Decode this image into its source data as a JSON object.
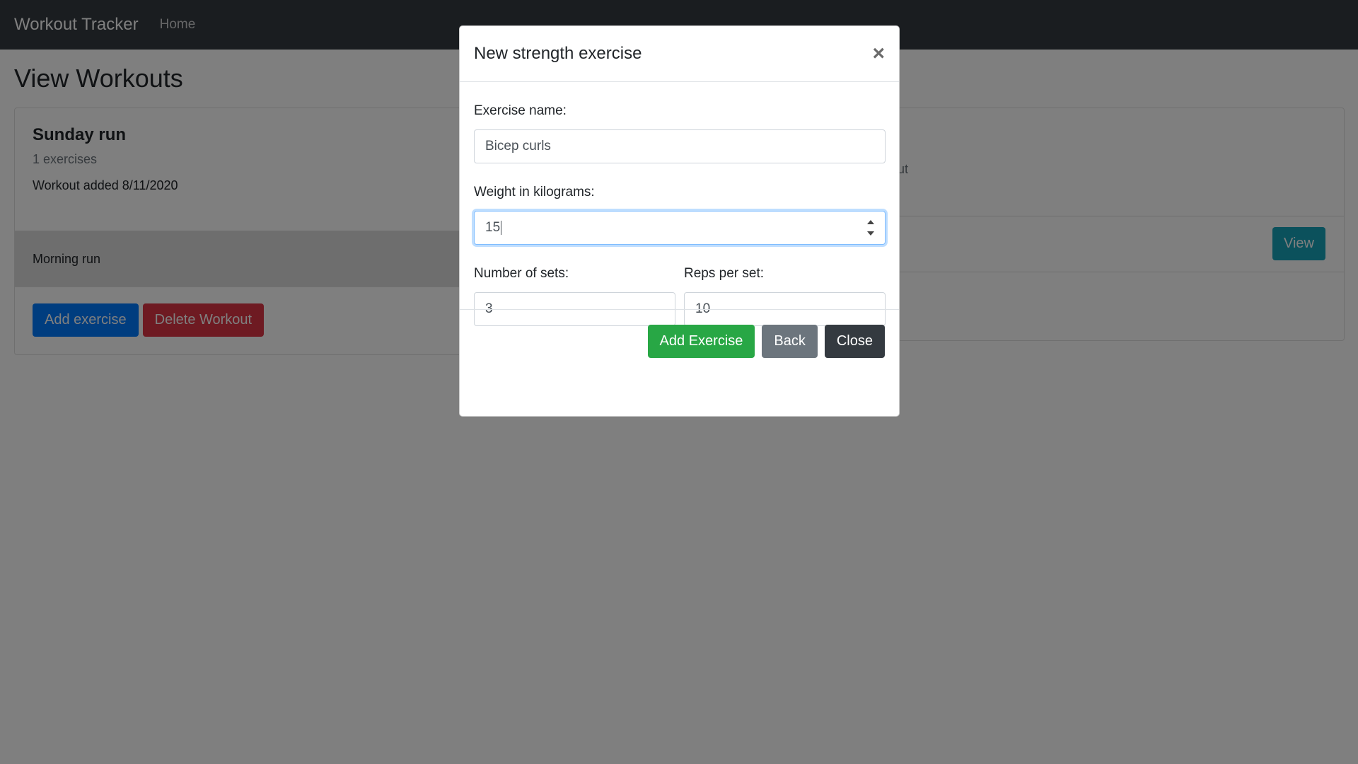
{
  "navbar": {
    "brand": "Workout Tracker",
    "home_link": "Home"
  },
  "page": {
    "title": "View Workouts"
  },
  "left_card": {
    "title": "Sunday run",
    "subtitle": "1 exercises",
    "text": "Workout added 8/11/2020",
    "list_item": "Morning run",
    "add_exercise_label": "Add exercise",
    "delete_workout_label": "Delete Workout"
  },
  "right_card": {
    "subtitle_fragment": "ut",
    "view_label": "View"
  },
  "modal": {
    "title": "New strength exercise",
    "close_symbol": "×",
    "exercise_name_label": "Exercise name:",
    "exercise_name_value": "Bicep curls",
    "weight_label": "Weight in kilograms:",
    "weight_value": "15",
    "sets_label": "Number of sets:",
    "sets_value": "3",
    "reps_label": "Reps per set:",
    "reps_value": "10",
    "add_exercise_label": "Add Exercise",
    "back_label": "Back",
    "close_label": "Close"
  },
  "colors": {
    "navbar": "#343a40",
    "primary": "#007bff",
    "danger": "#dc3545",
    "success": "#28a745",
    "secondary": "#6c757d",
    "dark": "#343a40",
    "info": "#17a2b8"
  }
}
